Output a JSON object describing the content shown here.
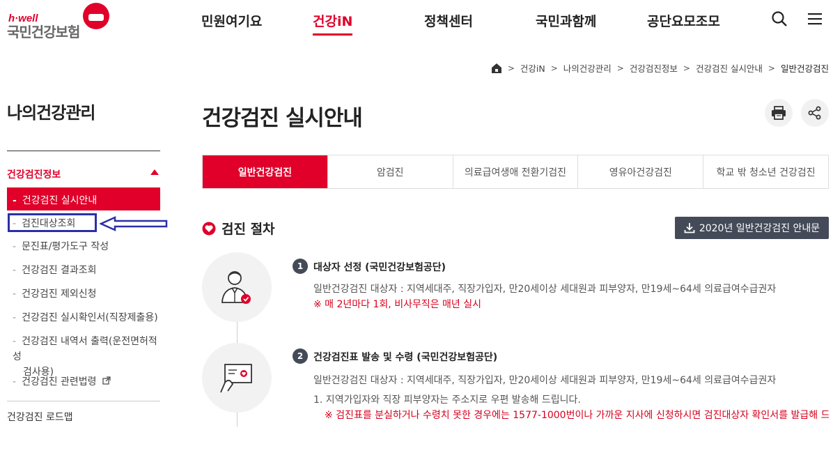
{
  "logo": {
    "small": "h·well",
    "name": "국민건강보험"
  },
  "gnb": [
    "민원여기요",
    "건강iN",
    "정책센터",
    "국민과함께",
    "공단요모조모"
  ],
  "gnb_active": "건강iN",
  "icons": {
    "search": "search-icon",
    "menu": "hamburger-menu-icon",
    "home": "home-icon",
    "print": "print-icon",
    "share": "share-icon"
  },
  "breadcrumb": [
    "건강iN",
    "나의건강관리",
    "건강검진정보",
    "건강검진 실시안내",
    "일반건강검진"
  ],
  "sidebar": {
    "title": "나의건강관리",
    "section": "건강검진정보",
    "active_item": "건강검진 실시안내",
    "items": [
      "검진대상조회",
      "문진표/평가도구 작성",
      "건강검진 결과조회",
      "건강검진 제외신청",
      "건강검진 실시확인서(직장제출용)",
      "건강검진 내역서 출력(운전면허적성",
      "검사용)",
      "건강검진 관련법령"
    ],
    "roadmap": "건강검진 로드맵"
  },
  "page_title": "건강검진 실시안내",
  "tabs": [
    "일반건강검진",
    "암검진",
    "의료급여생애 전환기검진",
    "영유아건강검진",
    "학교 밖 청소년 건강검진"
  ],
  "section_title": "검진 절차",
  "download_button": "2020년 일반건강검진 안내문",
  "steps": [
    {
      "num": "1",
      "title": "대상자 선정 (국민건강보험공단)",
      "text": "일반건강검진 대상자 : 지역세대주, 직장가입자, 만20세이상 세대원과 피부양자, 만19세~64세 의료급여수급권자",
      "note": "※ 매 2년마다 1회, 비사무직은 매년 실시"
    },
    {
      "num": "2",
      "title": "건강검진표 발송 및 수령 (국민건강보험공단)",
      "text": "일반건강검진 대상자 : 지역세대주, 직장가입자, 만20세이상 세대원과 피부양자, 만19세~64세 의료급여수급권자",
      "text2": "1. 지역가입자와 직장 피부양자는 주소지로 우편 발송해 드립니다.",
      "note": "※ 검진표를 분실하거나 수령치 못한 경우에는 1577-1000번이나 가까운 지사에 신청하시면 검진대상자 확인서를 발급해 드립니"
    }
  ],
  "colors": {
    "brand": "#e0002a",
    "dark_button": "#444a58",
    "annotation": "#2a2fa8"
  }
}
